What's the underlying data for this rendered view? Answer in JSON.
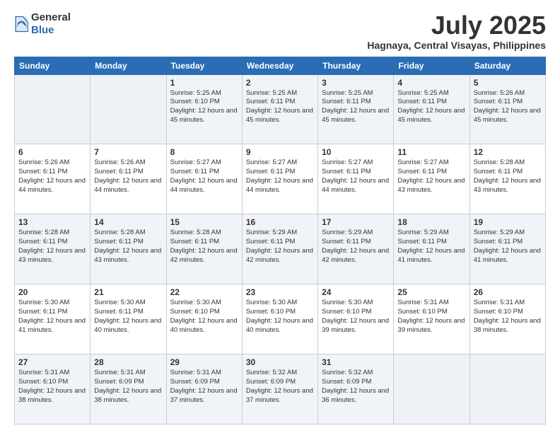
{
  "header": {
    "logo_general": "General",
    "logo_blue": "Blue",
    "month": "July 2025",
    "location": "Hagnaya, Central Visayas, Philippines"
  },
  "weekdays": [
    "Sunday",
    "Monday",
    "Tuesday",
    "Wednesday",
    "Thursday",
    "Friday",
    "Saturday"
  ],
  "weeks": [
    [
      {
        "day": "",
        "info": ""
      },
      {
        "day": "",
        "info": ""
      },
      {
        "day": "1",
        "info": "Sunrise: 5:25 AM\nSunset: 6:10 PM\nDaylight: 12 hours and 45 minutes."
      },
      {
        "day": "2",
        "info": "Sunrise: 5:25 AM\nSunset: 6:11 PM\nDaylight: 12 hours and 45 minutes."
      },
      {
        "day": "3",
        "info": "Sunrise: 5:25 AM\nSunset: 6:11 PM\nDaylight: 12 hours and 45 minutes."
      },
      {
        "day": "4",
        "info": "Sunrise: 5:25 AM\nSunset: 6:11 PM\nDaylight: 12 hours and 45 minutes."
      },
      {
        "day": "5",
        "info": "Sunrise: 5:26 AM\nSunset: 6:11 PM\nDaylight: 12 hours and 45 minutes."
      }
    ],
    [
      {
        "day": "6",
        "info": "Sunrise: 5:26 AM\nSunset: 6:11 PM\nDaylight: 12 hours and 44 minutes."
      },
      {
        "day": "7",
        "info": "Sunrise: 5:26 AM\nSunset: 6:11 PM\nDaylight: 12 hours and 44 minutes."
      },
      {
        "day": "8",
        "info": "Sunrise: 5:27 AM\nSunset: 6:11 PM\nDaylight: 12 hours and 44 minutes."
      },
      {
        "day": "9",
        "info": "Sunrise: 5:27 AM\nSunset: 6:11 PM\nDaylight: 12 hours and 44 minutes."
      },
      {
        "day": "10",
        "info": "Sunrise: 5:27 AM\nSunset: 6:11 PM\nDaylight: 12 hours and 44 minutes."
      },
      {
        "day": "11",
        "info": "Sunrise: 5:27 AM\nSunset: 6:11 PM\nDaylight: 12 hours and 43 minutes."
      },
      {
        "day": "12",
        "info": "Sunrise: 5:28 AM\nSunset: 6:11 PM\nDaylight: 12 hours and 43 minutes."
      }
    ],
    [
      {
        "day": "13",
        "info": "Sunrise: 5:28 AM\nSunset: 6:11 PM\nDaylight: 12 hours and 43 minutes."
      },
      {
        "day": "14",
        "info": "Sunrise: 5:28 AM\nSunset: 6:11 PM\nDaylight: 12 hours and 43 minutes."
      },
      {
        "day": "15",
        "info": "Sunrise: 5:28 AM\nSunset: 6:11 PM\nDaylight: 12 hours and 42 minutes."
      },
      {
        "day": "16",
        "info": "Sunrise: 5:29 AM\nSunset: 6:11 PM\nDaylight: 12 hours and 42 minutes."
      },
      {
        "day": "17",
        "info": "Sunrise: 5:29 AM\nSunset: 6:11 PM\nDaylight: 12 hours and 42 minutes."
      },
      {
        "day": "18",
        "info": "Sunrise: 5:29 AM\nSunset: 6:11 PM\nDaylight: 12 hours and 41 minutes."
      },
      {
        "day": "19",
        "info": "Sunrise: 5:29 AM\nSunset: 6:11 PM\nDaylight: 12 hours and 41 minutes."
      }
    ],
    [
      {
        "day": "20",
        "info": "Sunrise: 5:30 AM\nSunset: 6:11 PM\nDaylight: 12 hours and 41 minutes."
      },
      {
        "day": "21",
        "info": "Sunrise: 5:30 AM\nSunset: 6:11 PM\nDaylight: 12 hours and 40 minutes."
      },
      {
        "day": "22",
        "info": "Sunrise: 5:30 AM\nSunset: 6:10 PM\nDaylight: 12 hours and 40 minutes."
      },
      {
        "day": "23",
        "info": "Sunrise: 5:30 AM\nSunset: 6:10 PM\nDaylight: 12 hours and 40 minutes."
      },
      {
        "day": "24",
        "info": "Sunrise: 5:30 AM\nSunset: 6:10 PM\nDaylight: 12 hours and 39 minutes."
      },
      {
        "day": "25",
        "info": "Sunrise: 5:31 AM\nSunset: 6:10 PM\nDaylight: 12 hours and 39 minutes."
      },
      {
        "day": "26",
        "info": "Sunrise: 5:31 AM\nSunset: 6:10 PM\nDaylight: 12 hours and 38 minutes."
      }
    ],
    [
      {
        "day": "27",
        "info": "Sunrise: 5:31 AM\nSunset: 6:10 PM\nDaylight: 12 hours and 38 minutes."
      },
      {
        "day": "28",
        "info": "Sunrise: 5:31 AM\nSunset: 6:09 PM\nDaylight: 12 hours and 38 minutes."
      },
      {
        "day": "29",
        "info": "Sunrise: 5:31 AM\nSunset: 6:09 PM\nDaylight: 12 hours and 37 minutes."
      },
      {
        "day": "30",
        "info": "Sunrise: 5:32 AM\nSunset: 6:09 PM\nDaylight: 12 hours and 37 minutes."
      },
      {
        "day": "31",
        "info": "Sunrise: 5:32 AM\nSunset: 6:09 PM\nDaylight: 12 hours and 36 minutes."
      },
      {
        "day": "",
        "info": ""
      },
      {
        "day": "",
        "info": ""
      }
    ]
  ]
}
